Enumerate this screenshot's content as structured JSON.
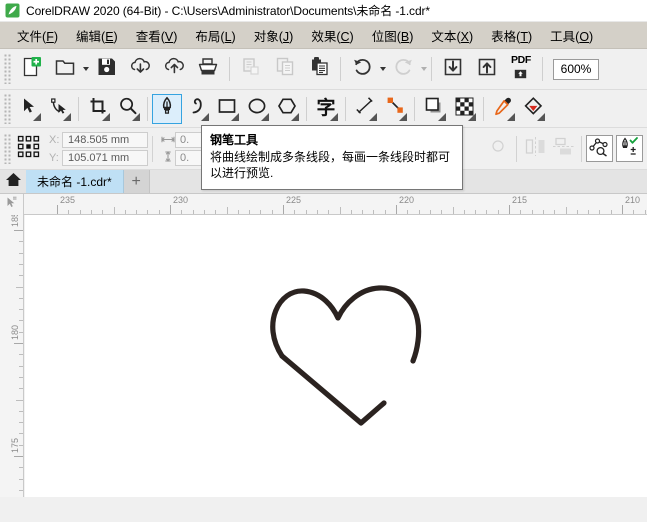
{
  "window": {
    "title": "CorelDRAW 2020 (64-Bit) - C:\\Users\\Administrator\\Documents\\未命名 -1.cdr*",
    "logo_icon": "coreldraw-balloon-icon"
  },
  "menubar": {
    "items": [
      {
        "label": "文件",
        "mnemonic": "F",
        "name": "menu-file"
      },
      {
        "label": "编辑",
        "mnemonic": "E",
        "name": "menu-edit"
      },
      {
        "label": "查看",
        "mnemonic": "V",
        "name": "menu-view"
      },
      {
        "label": "布局",
        "mnemonic": "L",
        "name": "menu-layout"
      },
      {
        "label": "对象",
        "mnemonic": "J",
        "name": "menu-object"
      },
      {
        "label": "效果",
        "mnemonic": "C",
        "name": "menu-effects"
      },
      {
        "label": "位图",
        "mnemonic": "B",
        "name": "menu-bitmaps"
      },
      {
        "label": "文本",
        "mnemonic": "X",
        "name": "menu-text"
      },
      {
        "label": "表格",
        "mnemonic": "T",
        "name": "menu-table"
      },
      {
        "label": "工具",
        "mnemonic": "O",
        "name": "menu-tools"
      }
    ]
  },
  "toolbar": {
    "buttons": [
      {
        "icon": "new-document-icon",
        "enabled": true
      },
      {
        "icon": "open-document-icon",
        "enabled": true,
        "has_dropdown": true
      },
      {
        "icon": "save-icon",
        "enabled": true
      },
      {
        "icon": "cloud-download-icon",
        "enabled": true
      },
      {
        "icon": "cloud-upload-icon",
        "enabled": true
      },
      {
        "icon": "print-icon",
        "enabled": true
      },
      {
        "icon": "cut-icon",
        "enabled": false
      },
      {
        "icon": "copy-icon",
        "enabled": false
      },
      {
        "icon": "paste-icon",
        "enabled": true
      },
      {
        "icon": "undo-icon",
        "enabled": true,
        "has_dropdown": true
      },
      {
        "icon": "redo-icon",
        "enabled": false,
        "has_dropdown": true
      },
      {
        "icon": "import-icon",
        "enabled": true
      },
      {
        "icon": "export-icon",
        "enabled": true
      },
      {
        "icon": "export-pdf-icon",
        "enabled": true
      }
    ],
    "pdf_label": "PDF",
    "zoom_level": "600%"
  },
  "toolbox": {
    "tools": [
      {
        "name": "pick-tool",
        "icon": "arrow-cursor-icon",
        "active": false,
        "flyout": true
      },
      {
        "name": "shape-tool",
        "icon": "node-edit-icon",
        "active": false,
        "flyout": true
      },
      {
        "name": "crop-tool",
        "icon": "crop-icon",
        "active": false,
        "flyout": true
      },
      {
        "name": "zoom-tool",
        "icon": "magnifier-icon",
        "active": false,
        "flyout": true
      },
      {
        "name": "pen-tool",
        "icon": "pen-nib-icon",
        "active": true,
        "flyout": false
      },
      {
        "name": "freehand-tool",
        "icon": "curve-squiggle-icon",
        "active": false,
        "flyout": true
      },
      {
        "name": "rectangle-tool",
        "icon": "rectangle-icon",
        "active": false,
        "flyout": true
      },
      {
        "name": "ellipse-tool",
        "icon": "ellipse-icon",
        "active": false,
        "flyout": true
      },
      {
        "name": "polygon-tool",
        "icon": "polygon-icon",
        "active": false,
        "flyout": true
      },
      {
        "name": "text-tool",
        "icon": "text-character-icon",
        "active": false,
        "flyout": true
      },
      {
        "name": "dimension-tool",
        "icon": "dimension-line-icon",
        "active": false,
        "flyout": true
      },
      {
        "name": "connector-tool",
        "icon": "connector-node-icon",
        "active": false,
        "flyout": true
      },
      {
        "name": "shadow-tool",
        "icon": "drop-shadow-icon",
        "active": false,
        "flyout": true
      },
      {
        "name": "transparency-tool",
        "icon": "checkerboard-transparency-icon",
        "active": false,
        "flyout": true
      },
      {
        "name": "color-eyedropper-tool",
        "icon": "eyedropper-icon",
        "active": false,
        "flyout": true
      },
      {
        "name": "interactive-fill-tool",
        "icon": "fill-bucket-icon",
        "active": false,
        "flyout": true
      }
    ],
    "text_tool_glyph": "字"
  },
  "tooltip": {
    "title": "钢笔工具",
    "body": "将曲线绘制成多条线段，每画一条线段时都可以进行预览."
  },
  "propertybar": {
    "object_position_icon": "object-origin-grid-icon",
    "x_label": "X:",
    "y_label": "Y:",
    "x_value": "148.505 mm",
    "y_value": "105.071 mm",
    "width_value": "0.",
    "height_value": "0.",
    "buttons": [
      {
        "name": "scale-lock-button",
        "icon": "lock-ratio-icon",
        "enabled": false
      },
      {
        "name": "rotation-angle-button",
        "icon": "rotation-icon",
        "enabled": false
      },
      {
        "name": "mirror-horizontal-button",
        "icon": "mirror-horizontal-icon",
        "enabled": false
      },
      {
        "name": "mirror-vertical-button",
        "icon": "mirror-vertical-icon",
        "enabled": false
      },
      {
        "name": "outline-width-button",
        "icon": "outline-width-icon",
        "enabled": false
      },
      {
        "name": "wrap-text-button",
        "icon": "text-wrap-icon",
        "enabled": false
      },
      {
        "name": "edit-bezier-button",
        "icon": "bezier-preview-icon",
        "enabled": true
      },
      {
        "name": "pen-options-button",
        "icon": "pen-autoclose-icon",
        "enabled": true
      }
    ]
  },
  "tabbar": {
    "home_icon": "home-icon",
    "document_tab": "未命名 -1.cdr*",
    "add_tab_label": "+"
  },
  "rulers": {
    "unit": "mm",
    "horizontal_labels": [
      "235",
      "230",
      "225",
      "220",
      "215",
      "210"
    ],
    "vertical_labels": [
      "185",
      "180",
      "175"
    ],
    "origin_icon": "ruler-origin-icon"
  },
  "canvas": {
    "drawing_name": "heart-outline-path",
    "stroke_color": "#2b2320",
    "background_color": "#ffffff",
    "stroke_width_px": 5
  }
}
